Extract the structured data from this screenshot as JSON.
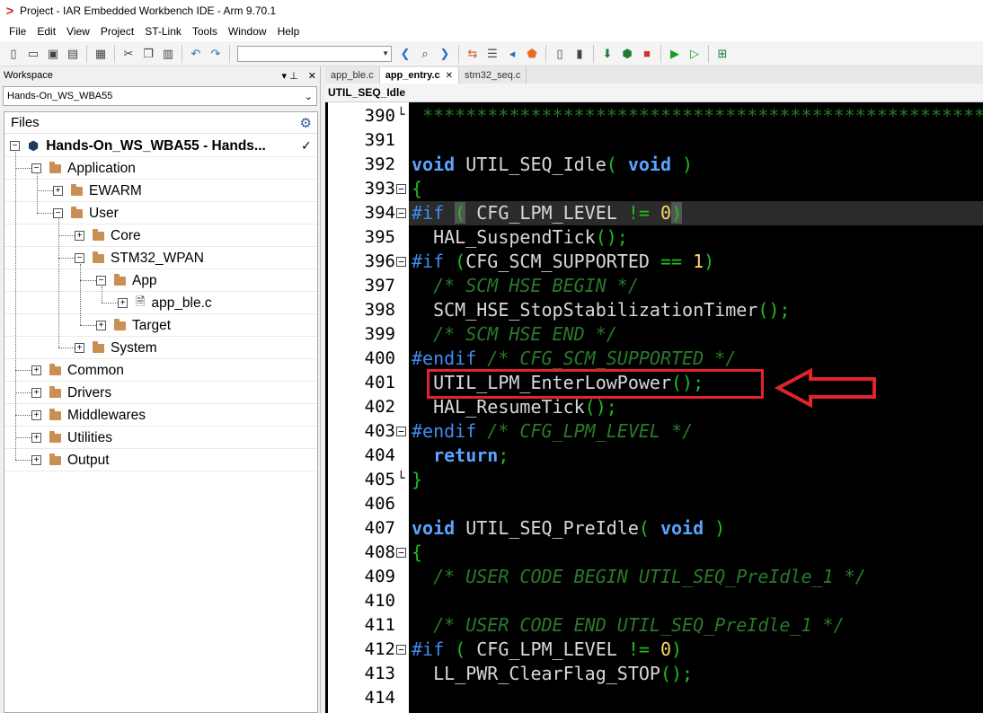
{
  "window": {
    "title": "Project - IAR Embedded Workbench IDE - Arm 9.70.1"
  },
  "menu": [
    "File",
    "Edit",
    "View",
    "Project",
    "ST-Link",
    "Tools",
    "Window",
    "Help"
  ],
  "colors": {
    "accent_red": "#e0242a",
    "folder": "#c98f55",
    "editor_bg": "#000000",
    "keyword": "#5ba3ff",
    "comment": "#2a7a2a",
    "number": "#ffd966"
  },
  "workspace": {
    "title": "Workspace",
    "pin_glyph": "▾ ⊥",
    "close_glyph": "✕",
    "selected": "Hands-On_WS_WBA55",
    "files_label": "Files",
    "tree": [
      {
        "label": "Hands-On_WS_WBA55 - Hands...",
        "level": 0,
        "type": "project",
        "expander": "−",
        "check": "✓"
      },
      {
        "label": "Application",
        "level": 1,
        "type": "folder",
        "expander": "−"
      },
      {
        "label": "EWARM",
        "level": 2,
        "type": "folder",
        "expander": "+"
      },
      {
        "label": "User",
        "level": 2,
        "type": "folder",
        "expander": "−"
      },
      {
        "label": "Core",
        "level": 3,
        "type": "folder",
        "expander": "+"
      },
      {
        "label": "STM32_WPAN",
        "level": 3,
        "type": "folder",
        "expander": "−"
      },
      {
        "label": "App",
        "level": 4,
        "type": "folder",
        "expander": "−"
      },
      {
        "label": "app_ble.c",
        "level": 5,
        "type": "file",
        "expander": "+"
      },
      {
        "label": "Target",
        "level": 4,
        "type": "folder",
        "expander": "+"
      },
      {
        "label": "System",
        "level": 3,
        "type": "folder",
        "expander": "+"
      },
      {
        "label": "Common",
        "level": 1,
        "type": "folder",
        "expander": "+"
      },
      {
        "label": "Drivers",
        "level": 1,
        "type": "folder",
        "expander": "+"
      },
      {
        "label": "Middlewares",
        "level": 1,
        "type": "folder",
        "expander": "+"
      },
      {
        "label": "Utilities",
        "level": 1,
        "type": "folder",
        "expander": "+"
      },
      {
        "label": "Output",
        "level": 1,
        "type": "folder",
        "expander": "+"
      }
    ]
  },
  "tabs": [
    {
      "label": "app_ble.c",
      "active": false,
      "close": ""
    },
    {
      "label": "app_entry.c",
      "active": true,
      "close": "✕"
    },
    {
      "label": "stm32_seq.c",
      "active": false,
      "close": ""
    }
  ],
  "function_bar": "UTIL_SEQ_Idle",
  "code": [
    {
      "n": "390",
      "fold": "└",
      "tokens": [
        {
          "t": " ************************************************************",
          "c": "cmt-star"
        }
      ]
    },
    {
      "n": "391",
      "tokens": []
    },
    {
      "n": "392",
      "tokens": [
        {
          "t": "void",
          "c": "kw"
        },
        {
          "t": " UTIL_SEQ_Idle",
          "c": ""
        },
        {
          "t": "( ",
          "c": "gr"
        },
        {
          "t": "void",
          "c": "kw"
        },
        {
          "t": " )",
          "c": "gr"
        }
      ]
    },
    {
      "n": "393",
      "fold": "−",
      "tokens": [
        {
          "t": "{",
          "c": "gr"
        }
      ]
    },
    {
      "n": "394",
      "fold": "−",
      "hl": true,
      "tokens": [
        {
          "t": "#if",
          "c": "pp"
        },
        {
          "t": " ",
          "c": ""
        },
        {
          "t": "(",
          "c": "gr paren-hl"
        },
        {
          "t": " CFG_LPM_LEVEL ",
          "c": ""
        },
        {
          "t": "!=",
          "c": "gr"
        },
        {
          "t": " ",
          "c": ""
        },
        {
          "t": "0",
          "c": "num"
        },
        {
          "t": ")",
          "c": "gr paren-hl"
        }
      ]
    },
    {
      "n": "395",
      "tokens": [
        {
          "t": "  HAL_SuspendTick",
          "c": ""
        },
        {
          "t": "();",
          "c": "gr"
        }
      ]
    },
    {
      "n": "396",
      "fold": "−",
      "tokens": [
        {
          "t": "#if",
          "c": "pp"
        },
        {
          "t": " ",
          "c": ""
        },
        {
          "t": "(",
          "c": "gr"
        },
        {
          "t": "CFG_SCM_SUPPORTED ",
          "c": ""
        },
        {
          "t": "==",
          "c": "gr"
        },
        {
          "t": " ",
          "c": ""
        },
        {
          "t": "1",
          "c": "num"
        },
        {
          "t": ")",
          "c": "gr"
        }
      ]
    },
    {
      "n": "397",
      "tokens": [
        {
          "t": "  /* SCM HSE BEGIN */",
          "c": "cm"
        }
      ]
    },
    {
      "n": "398",
      "tokens": [
        {
          "t": "  SCM_HSE_StopStabilizationTimer",
          "c": ""
        },
        {
          "t": "();",
          "c": "gr"
        }
      ]
    },
    {
      "n": "399",
      "tokens": [
        {
          "t": "  /* SCM HSE END */",
          "c": "cm"
        }
      ]
    },
    {
      "n": "400",
      "tokens": [
        {
          "t": "#endif",
          "c": "pp"
        },
        {
          "t": " /* CFG_SCM_SUPPORTED */",
          "c": "cm"
        }
      ]
    },
    {
      "n": "401",
      "tokens": [
        {
          "t": "  UTIL_LPM_EnterLowPower",
          "c": ""
        },
        {
          "t": "();",
          "c": "gr"
        }
      ]
    },
    {
      "n": "402",
      "tokens": [
        {
          "t": "  HAL_ResumeTick",
          "c": ""
        },
        {
          "t": "();",
          "c": "gr"
        }
      ]
    },
    {
      "n": "403",
      "fold": "−",
      "tokens": [
        {
          "t": "#endif",
          "c": "pp"
        },
        {
          "t": " /* CFG_LPM_LEVEL */",
          "c": "cm"
        }
      ]
    },
    {
      "n": "404",
      "tokens": [
        {
          "t": "  ",
          "c": ""
        },
        {
          "t": "return",
          "c": "kw"
        },
        {
          "t": ";",
          "c": "gr"
        }
      ]
    },
    {
      "n": "405",
      "fold": "└",
      "tokens": [
        {
          "t": "}",
          "c": "gr"
        }
      ]
    },
    {
      "n": "406",
      "tokens": []
    },
    {
      "n": "407",
      "tokens": [
        {
          "t": "void",
          "c": "kw"
        },
        {
          "t": " UTIL_SEQ_PreIdle",
          "c": ""
        },
        {
          "t": "( ",
          "c": "gr"
        },
        {
          "t": "void",
          "c": "kw"
        },
        {
          "t": " )",
          "c": "gr"
        }
      ]
    },
    {
      "n": "408",
      "fold": "−",
      "tokens": [
        {
          "t": "{",
          "c": "gr"
        }
      ]
    },
    {
      "n": "409",
      "tokens": [
        {
          "t": "  /* USER CODE BEGIN UTIL_SEQ_PreIdle_1 */",
          "c": "cm"
        }
      ]
    },
    {
      "n": "410",
      "tokens": []
    },
    {
      "n": "411",
      "tokens": [
        {
          "t": "  /* USER CODE END UTIL_SEQ_PreIdle_1 */",
          "c": "cm"
        }
      ]
    },
    {
      "n": "412",
      "fold": "−",
      "tokens": [
        {
          "t": "#if",
          "c": "pp"
        },
        {
          "t": " ",
          "c": ""
        },
        {
          "t": "(",
          "c": "gr"
        },
        {
          "t": " CFG_LPM_LEVEL ",
          "c": ""
        },
        {
          "t": "!=",
          "c": "gr"
        },
        {
          "t": " ",
          "c": ""
        },
        {
          "t": "0",
          "c": "num"
        },
        {
          "t": ")",
          "c": "gr"
        }
      ]
    },
    {
      "n": "413",
      "tokens": [
        {
          "t": "  LL_PWR_ClearFlag_STOP",
          "c": ""
        },
        {
          "t": "();",
          "c": "gr"
        }
      ]
    },
    {
      "n": "414",
      "tokens": []
    }
  ],
  "toolbar_icons": [
    "new-file-icon",
    "open-icon",
    "save-icon",
    "save-all-icon",
    "print-icon",
    "cut-icon",
    "copy-icon",
    "paste-icon",
    "undo-icon",
    "redo-icon",
    "nav-back-icon",
    "find-icon",
    "nav-forward-icon",
    "replace-icon",
    "goto-icon",
    "bookmark-icon",
    "shield-icon",
    "file-compile-icon",
    "make-icon",
    "download-icon",
    "build-icon",
    "stop-icon",
    "debug-icon",
    "debug-nodownload-icon",
    "stack-icon"
  ]
}
